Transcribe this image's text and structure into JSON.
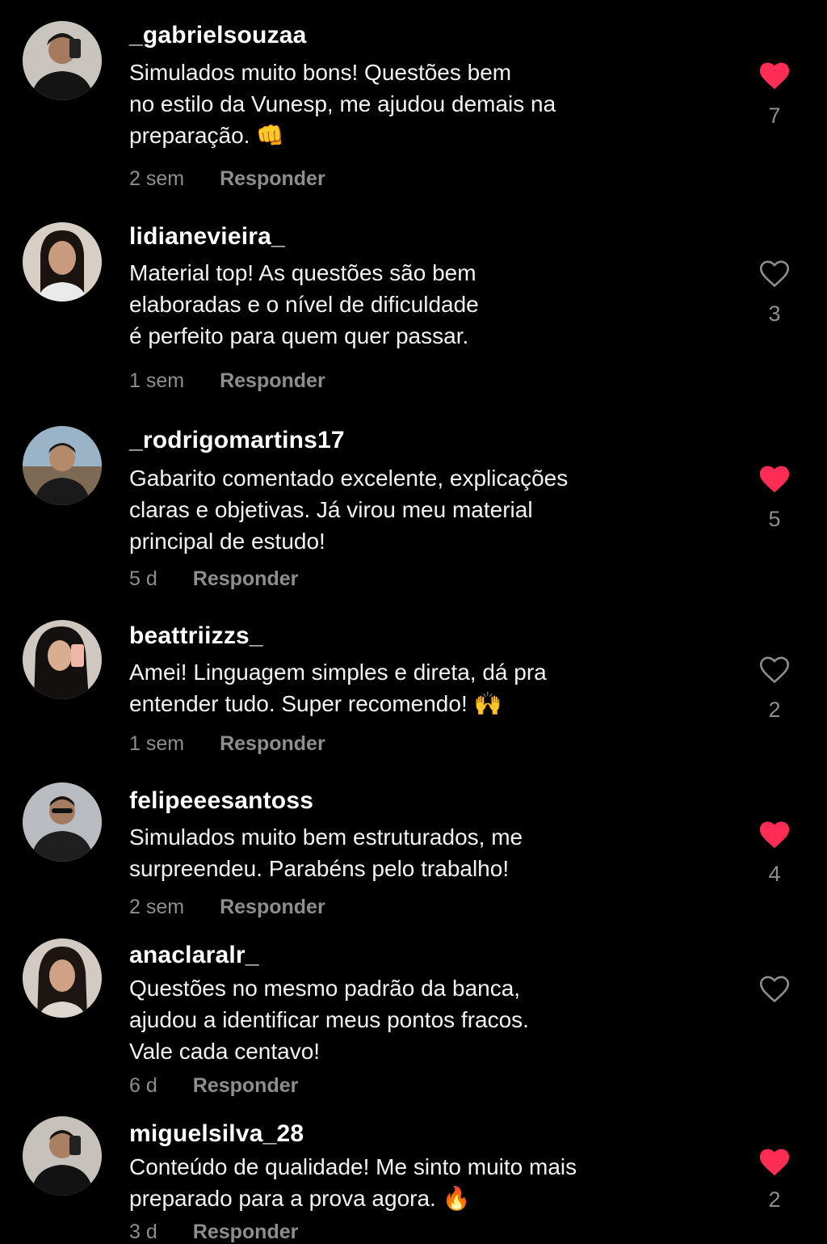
{
  "colors": {
    "background": "#000000",
    "like_active": "#ff2d55",
    "muted": "#8e8e8e"
  },
  "comments": [
    {
      "username": "_gabrielsouzaa",
      "lines": [
        "Simulados muito bons! Questões bem",
        "no estilo da Vunesp, me ajudou demais na",
        "preparação. 👊"
      ],
      "time": "2 sem",
      "reply": "Responder",
      "liked": true,
      "likes": "7",
      "like_icon": "heart-filled-icon"
    },
    {
      "username": "lidianevieira_",
      "lines": [
        "Material top! As questões são bem",
        "elaboradas e o nível de dificuldade",
        "é perfeito para quem quer passar."
      ],
      "time": "1 sem",
      "reply": "Responder",
      "liked": false,
      "likes": "3",
      "like_icon": "heart-outline-icon"
    },
    {
      "username": "_rodrigomartins17",
      "lines": [
        "Gabarito comentado excelente, explicações",
        "claras e objetivas. Já virou meu material",
        "principal de estudo!"
      ],
      "time": "5 d",
      "reply": "Responder",
      "liked": true,
      "likes": "5",
      "like_icon": "heart-filled-icon"
    },
    {
      "username": "beattriizzs_",
      "lines": [
        "Amei! Linguagem simples e direta, dá pra",
        "entender tudo. Super recomendo! 🙌"
      ],
      "time": "1 sem",
      "reply": "Responder",
      "liked": false,
      "likes": "2",
      "like_icon": "heart-outline-icon"
    },
    {
      "username": "felipeeesantoss",
      "lines": [
        "Simulados muito bem estruturados, me",
        "surpreendeu. Parabéns pelo trabalho!"
      ],
      "time": "2 sem",
      "reply": "Responder",
      "liked": true,
      "likes": "4",
      "like_icon": "heart-filled-icon"
    },
    {
      "username": "anaclaralr_",
      "lines": [
        "Questões no mesmo padrão da banca,",
        "ajudou a identificar meus pontos fracos.",
        "Vale cada centavo!"
      ],
      "time": "6 d",
      "reply": "Responder",
      "liked": false,
      "likes": "",
      "like_icon": "heart-outline-icon"
    },
    {
      "username": "miguelsilva_28",
      "lines": [
        "Conteúdo de qualidade! Me sinto muito mais",
        "preparado para a prova agora. 🔥"
      ],
      "time": "3 d",
      "reply": "Responder",
      "liked": true,
      "likes": "2",
      "like_icon": "heart-filled-icon"
    }
  ]
}
